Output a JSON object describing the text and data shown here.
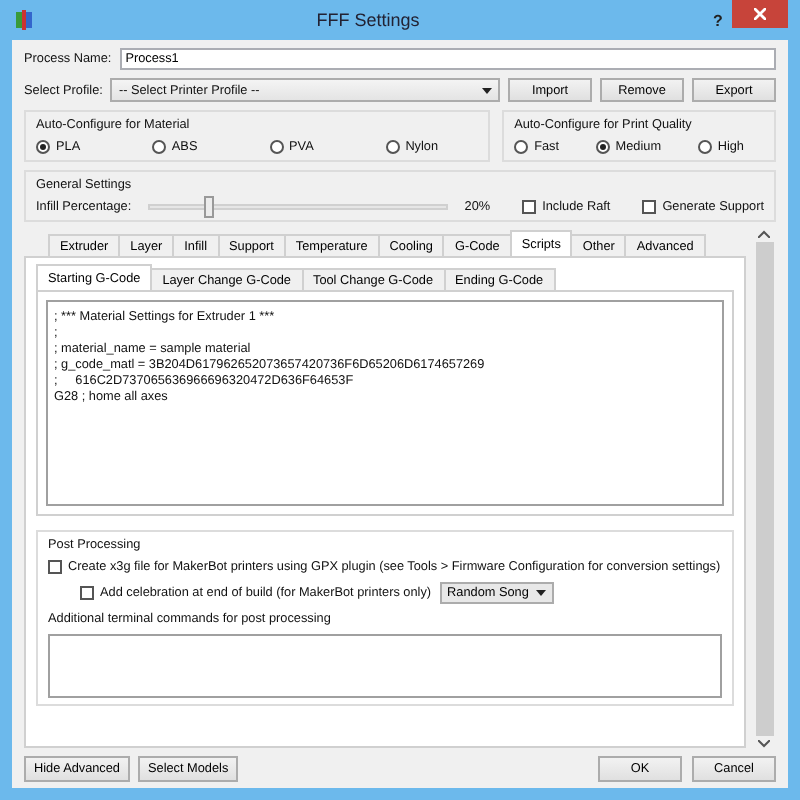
{
  "window": {
    "title": "FFF Settings",
    "help": "?"
  },
  "process_name": {
    "label": "Process Name:",
    "value": "Process1"
  },
  "profile": {
    "label": "Select Profile:",
    "value": "-- Select Printer Profile --",
    "buttons": [
      "Import",
      "Remove",
      "Export"
    ]
  },
  "material": {
    "title": "Auto-Configure for Material",
    "options": [
      {
        "label": "PLA",
        "selected": true
      },
      {
        "label": "ABS",
        "selected": false
      },
      {
        "label": "PVA",
        "selected": false
      },
      {
        "label": "Nylon",
        "selected": false
      }
    ]
  },
  "quality": {
    "title": "Auto-Configure for Print Quality",
    "options": [
      {
        "label": "Fast",
        "selected": false
      },
      {
        "label": "Medium",
        "selected": true
      },
      {
        "label": "High",
        "selected": false
      }
    ]
  },
  "general": {
    "title": "General Settings",
    "infill_label": "Infill Percentage:",
    "infill": {
      "level": 0.2
    },
    "infill_reading": "20%",
    "checkboxes": [
      {
        "label": "Include Raft",
        "checked": false
      },
      {
        "label": "Generate Support",
        "checked": false
      }
    ]
  },
  "tabs": [
    {
      "label": "Extruder",
      "selected": false
    },
    {
      "label": "Layer",
      "selected": false
    },
    {
      "label": "Infill",
      "selected": false
    },
    {
      "label": "Support",
      "selected": false
    },
    {
      "label": "Temperature",
      "selected": false
    },
    {
      "label": "Cooling",
      "selected": false
    },
    {
      "label": "G-Code",
      "selected": false
    },
    {
      "label": "Scripts",
      "selected": true
    },
    {
      "label": "Other",
      "selected": false
    },
    {
      "label": "Advanced",
      "selected": false
    }
  ],
  "script_tabs": [
    {
      "label": "Starting G-Code",
      "selected": true
    },
    {
      "label": "Layer Change G-Code",
      "selected": false
    },
    {
      "label": "Tool Change G-Code",
      "selected": false
    },
    {
      "label": "Ending G-Code",
      "selected": false
    }
  ],
  "gcode_lines": [
    "; *** Material Settings for Extruder 1 ***",
    ";",
    "; material_name = sample material",
    "; g_code_matl = 3B204D617962652073657420736F6D65206D6174657269",
    ";     616C2D737065636966696320472D636F64653F",
    "G28 ; home all axes"
  ],
  "post_processing": {
    "title": "Post Processing",
    "x3g": {
      "label": "Create x3g file for MakerBot printers using GPX plugin (see Tools > Firmware Configuration for conversion settings)",
      "checked": false
    },
    "celebration": {
      "label": "Add celebration at end of build (for MakerBot printers only)",
      "checked": false,
      "song": "Random Song"
    },
    "terminal_label": "Additional terminal commands for post processing"
  },
  "footer": {
    "left": [
      "Hide Advanced",
      "Select Models"
    ],
    "right": [
      "OK",
      "Cancel"
    ]
  }
}
